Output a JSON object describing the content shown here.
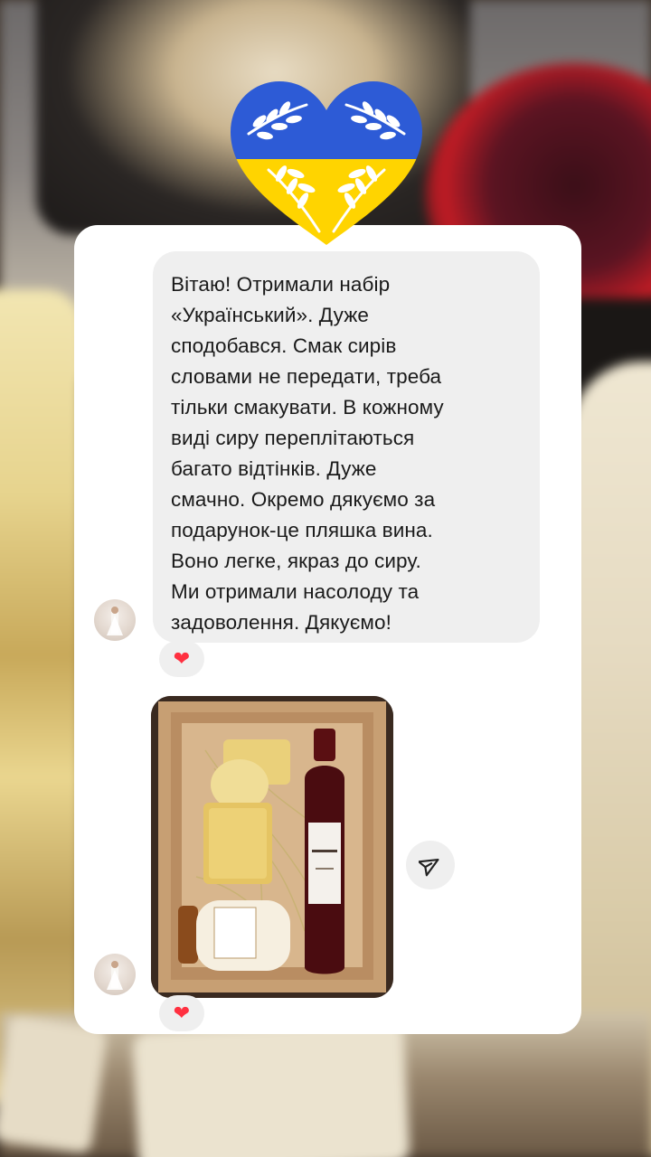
{
  "message": {
    "text": "Вітаю! Отримали набір\n«Український». Дуже\nсподобався. Смак сирів\nсловами не передати, треба\nтільки смакувати.    В кожному\nвиді сиру переплітаються\nбагато відтінків. Дуже\nсмачно. Окремо дякуємо за\nподарунок-це пляшка вина.\nВоно легке, якраз до сиру.\nМи отримали насолоду та\nзадоволення. Дякуємо!",
    "reaction": "❤"
  },
  "photo_message": {
    "reaction": "❤"
  },
  "icons": {
    "heart_flag": "ukraine-heart-icon",
    "share": "send-icon",
    "reaction": "red-heart-icon"
  },
  "colors": {
    "flag_blue": "#2d5bd6",
    "flag_yellow": "#ffd400",
    "reaction_red": "#ff3040",
    "bubble_gray": "#efefef"
  }
}
